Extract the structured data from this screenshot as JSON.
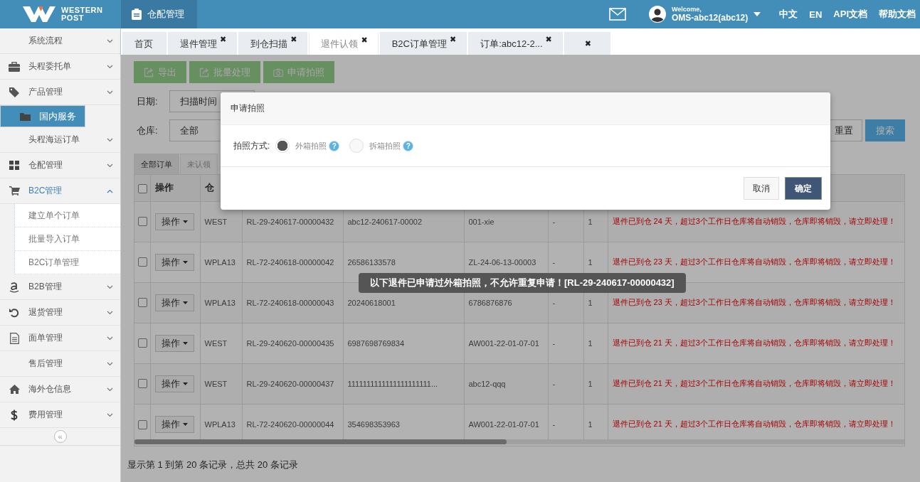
{
  "header": {
    "logo_lines": [
      "WESTERN",
      "POST"
    ],
    "module": "仓配管理",
    "welcome": "Welcome,",
    "user": "OMS-abc12(abc12)",
    "links": [
      "中文",
      "EN",
      "API文档",
      "帮助文档"
    ]
  },
  "sidebar": {
    "items": [
      {
        "label": "系统流程",
        "selected": false,
        "expanded": false
      },
      {
        "label": "头程委托单",
        "selected": false,
        "expanded": false
      },
      {
        "label": "产品管理",
        "selected": false,
        "expanded": false
      },
      {
        "label": "国内服务",
        "selected": true
      },
      {
        "label": "头程海运订单",
        "selected": false,
        "expanded": false
      },
      {
        "label": "仓配管理",
        "selected": false,
        "expanded": false
      },
      {
        "label": "B2C管理",
        "selected": false,
        "expanded": true,
        "children": [
          {
            "label": "建立单个订单"
          },
          {
            "label": "批量导入订单"
          },
          {
            "label": "B2C订单管理"
          }
        ]
      },
      {
        "label": "B2B管理",
        "selected": false,
        "expanded": false
      },
      {
        "label": "退货管理",
        "selected": false,
        "expanded": false
      },
      {
        "label": "面单管理",
        "selected": false,
        "expanded": false
      },
      {
        "label": "售后管理",
        "selected": false,
        "expanded": false
      },
      {
        "label": "海外仓信息",
        "selected": false,
        "expanded": false
      },
      {
        "label": "费用管理",
        "selected": false,
        "expanded": false
      }
    ],
    "collapse": "«"
  },
  "tabs": [
    {
      "label": "首页",
      "selected": false
    },
    {
      "label": "退件管理",
      "selected": false,
      "close": "✖"
    },
    {
      "label": "到仓扫描",
      "selected": false,
      "close": "✖"
    },
    {
      "label": "退件认领",
      "selected": true,
      "close": "✖"
    },
    {
      "label": "B2C订单管理",
      "selected": false,
      "close": "✖"
    },
    {
      "label": "订单:abc12-2...",
      "selected": false,
      "close": "✖"
    },
    {
      "selected": false,
      "close": "✖"
    }
  ],
  "toolbar": [
    "导出",
    "批量处理",
    "申请拍照"
  ],
  "filters": {
    "date_label": "日期:",
    "date_type": "扫描时间",
    "warehouse_label": "仓库:",
    "warehouse": "全部",
    "buttons": [
      "重置",
      "搜索"
    ]
  },
  "order_tabs": [
    {
      "label": "全部订单",
      "selected": true
    },
    {
      "label": "未认领",
      "selected": false
    }
  ],
  "table": {
    "all_checked": false,
    "columns": [
      "操作",
      "仓"
    ],
    "rows": [
      {
        "checked": false,
        "cells": [
          "操作",
          "WEST",
          "RL-29-240617-00000432",
          "abc12-240617-00002",
          "001-xie",
          "-",
          "1"
        ],
        "message": "退件已到仓 24 天，超过3个工作日仓库将自动销毁，仓库即将销毁，请立即处理！"
      },
      {
        "checked": false,
        "cells": [
          "操作",
          "WPLA13",
          "RL-72-240618-00000042",
          "26586133578",
          "ZL-24-06-13-00003",
          "-",
          "1"
        ],
        "message": "退件已到仓 23 天，超过3个工作日仓库将自动销毁，仓库即将销毁，请立即处理！"
      },
      {
        "checked": false,
        "cells": [
          "操作",
          "WPLA13",
          "RL-72-240618-00000043",
          "20240618001",
          "6786876876",
          "-",
          "1"
        ],
        "message": "退件已到仓 23 天，超过3个工作日仓库将自动销毁，仓库即将销毁，请立即处理！"
      },
      {
        "checked": false,
        "cells": [
          "操作",
          "WEST",
          "RL-29-240620-00000435",
          "6987698769834",
          "AW001-22-01-07-01",
          "-",
          "1"
        ],
        "message": "退件已到仓 21 天，超过3个工作日仓库将自动销毁，仓库即将销毁，请立即处理！"
      },
      {
        "checked": false,
        "cells": [
          "操作",
          "WEST",
          "RL-29-240620-00000437",
          "1111111111111111111111...",
          "abc12-qqq",
          "-",
          "1"
        ],
        "message": "退件已到仓 21 天，超过3个工作日仓库将自动销毁，仓库即将销毁，请立即处理！"
      },
      {
        "checked": false,
        "cells": [
          "操作",
          "WPLA13",
          "RL-72-240620-00000044",
          "354698353963",
          "AW001-22-01-07-01",
          "-",
          "1"
        ],
        "message": "退件已到仓 21 天，超过3个工作日仓库将自动销毁，仓库即将销毁，请立即处理！"
      }
    ]
  },
  "footer": "显示第 1 到第 20 条记录，总共 20 条记录",
  "modal": {
    "title": "申请拍照",
    "label": "拍照方式:",
    "options": [
      {
        "label": "外箱拍照",
        "selected": true,
        "help": "?"
      },
      {
        "label": "拆箱拍照",
        "selected": false,
        "help": "?"
      }
    ],
    "buttons": [
      "取消",
      "确定"
    ]
  },
  "toast": "以下退件已申请过外箱拍照，不允许重复申请！[RL-29-240617-00000432]"
}
